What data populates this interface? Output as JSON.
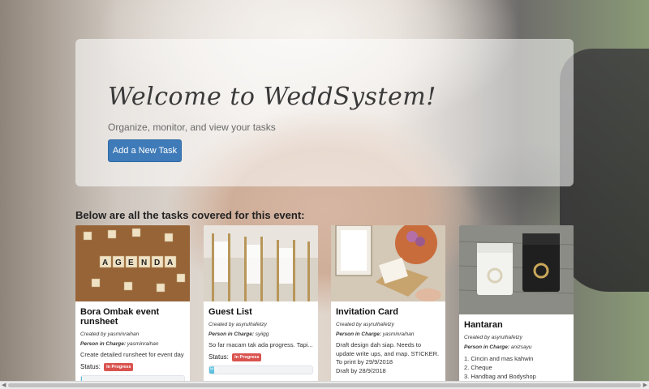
{
  "hero": {
    "title": "Welcome to WeddSystem!",
    "subtitle": "Organize, monitor, and view your tasks",
    "button_label": "Add a New Task"
  },
  "section_title": "Below are all the tasks covered for this event:",
  "cards": [
    {
      "title": "Bora Ombak event runsheet",
      "created_by": "Created by yasminraihan",
      "person_label": "Person in Charge:",
      "person": "yasminraihan",
      "description": "Create detailed runsheet for event day",
      "status_label": "Status:",
      "status": "In Progress",
      "progress": 0
    },
    {
      "title": "Guest List",
      "created_by": "Created by asyrulhafetzy",
      "person_label": "Person in Charge:",
      "person": "syiigg",
      "description": "So far macam tak ada progress. Tapi...",
      "status_label": "Status:",
      "status": "In Progress",
      "progress": 5,
      "progress_text": "5%"
    },
    {
      "title": "Invitation Card",
      "created_by": "Created by asyrulhafetzy",
      "person_label": "Person in Charge:",
      "person": "yasminraihan",
      "description": "Draft design dah siap. Needs to update write ups, and map. STICKER.",
      "line2": "To print by 29/9/2018",
      "line3": "Draft by 28/9/2018"
    },
    {
      "title": "Hantaran",
      "created_by": "Created by asyrulhafetzy",
      "person_label": "Person in Charge:",
      "person": "anizsayu",
      "items": [
        "1. Cincin and mas kahwin",
        "2. Cheque",
        "3. Handbag and Bodyshop"
      ]
    }
  ],
  "colors": {
    "primary_button": "#3f7bb8",
    "badge_red": "#d9534f",
    "progress_info": "#5bc0de"
  },
  "icons": {
    "scroll_left": "◀",
    "scroll_right": "▶"
  }
}
